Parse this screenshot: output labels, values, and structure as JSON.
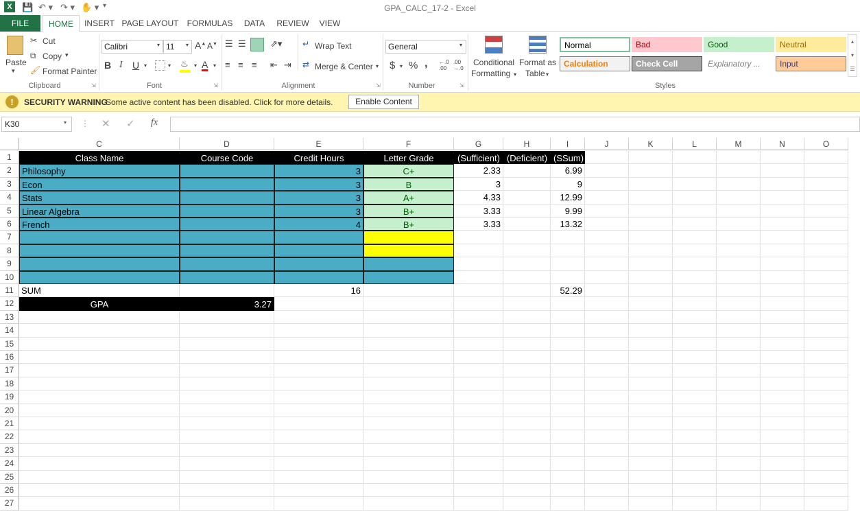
{
  "window": {
    "title": "GPA_CALC_17-2 - Excel"
  },
  "quick_access": {
    "save_icon": "save-icon",
    "undo_icon": "undo-icon",
    "redo_icon": "redo-icon",
    "touch_icon": "touch-mode-icon",
    "customize_icon": "customize-icon"
  },
  "tabs": [
    "FILE",
    "HOME",
    "INSERT",
    "PAGE LAYOUT",
    "FORMULAS",
    "DATA",
    "REVIEW",
    "VIEW"
  ],
  "ribbon": {
    "clipboard": {
      "paste": "Paste",
      "cut": "Cut",
      "copy": "Copy",
      "format_painter": "Format Painter",
      "label": "Clipboard"
    },
    "font": {
      "name": "Calibri",
      "size": "11",
      "label": "Font",
      "bold": "B",
      "italic": "I",
      "underline": "U"
    },
    "alignment": {
      "wrap_text": "Wrap Text",
      "merge_center": "Merge & Center",
      "label": "Alignment"
    },
    "number": {
      "format": "General",
      "label": "Number",
      "currency": "$",
      "percent": "%",
      "comma": ","
    },
    "cond_format": {
      "line1": "Conditional",
      "line2": "Formatting"
    },
    "format_table": {
      "line1": "Format as",
      "line2": "Table"
    },
    "styles": {
      "label": "Styles",
      "items": [
        {
          "name": "Normal",
          "bg": "#ffffff",
          "fg": "#000000",
          "border": "#7fbf9f"
        },
        {
          "name": "Bad",
          "bg": "#ffc7ce",
          "fg": "#9c0006"
        },
        {
          "name": "Good",
          "bg": "#c6efce",
          "fg": "#006100"
        },
        {
          "name": "Neutral",
          "bg": "#ffeb9c",
          "fg": "#9c6500"
        },
        {
          "name": "Calculation",
          "bg": "#f2f2f2",
          "fg": "#fa7d00",
          "border": "#7f7f7f"
        },
        {
          "name": "Check Cell",
          "bg": "#a5a5a5",
          "fg": "#ffffff",
          "border": "#3f3f3f"
        },
        {
          "name": "Explanatory ...",
          "bg": "#ffffff",
          "fg": "#7f7f7f"
        },
        {
          "name": "Input",
          "bg": "#ffcc99",
          "fg": "#3f3f76",
          "border": "#7f7f7f"
        }
      ]
    }
  },
  "security": {
    "title": "SECURITY WARNING",
    "message": "Some active content has been disabled. Click for more details.",
    "button": "Enable Content"
  },
  "formula_bar": {
    "name_box": "K30",
    "fx": "fx",
    "value": ""
  },
  "columns": [
    "C",
    "D",
    "E",
    "F",
    "G",
    "H",
    "I",
    "J",
    "K",
    "L",
    "M",
    "N",
    "O"
  ],
  "rows": [
    "1",
    "2",
    "3",
    "4",
    "5",
    "6",
    "7",
    "8",
    "9",
    "10",
    "11",
    "12",
    "13",
    "14",
    "15",
    "16",
    "17",
    "18",
    "19",
    "20",
    "21",
    "22",
    "23",
    "24",
    "25",
    "26",
    "27"
  ],
  "sheet": {
    "headers": [
      "Class Name",
      "Course Code",
      "Credit Hours",
      "Letter Grade",
      "(Sufficient)",
      "(Deficient)",
      "(SSum)"
    ],
    "classes": [
      {
        "name": "Philosophy",
        "code": "",
        "hours": "3",
        "grade": "C+",
        "sufficient": "2.33",
        "deficient": "",
        "ssum": "6.99"
      },
      {
        "name": "Econ",
        "code": "",
        "hours": "3",
        "grade": "B",
        "sufficient": "3",
        "deficient": "",
        "ssum": "9"
      },
      {
        "name": "Stats",
        "code": "",
        "hours": "3",
        "grade": "A+",
        "sufficient": "4.33",
        "deficient": "",
        "ssum": "12.99"
      },
      {
        "name": "Linear Algebra",
        "code": "",
        "hours": "3",
        "grade": "B+",
        "sufficient": "3.33",
        "deficient": "",
        "ssum": "9.99"
      },
      {
        "name": "French",
        "code": "",
        "hours": "4",
        "grade": "B+",
        "sufficient": "3.33",
        "deficient": "",
        "ssum": "13.32"
      }
    ],
    "sum_label": "SUM",
    "sum_hours": "16",
    "sum_ssum": "52.29",
    "gpa_label": "GPA",
    "gpa_value": "3.27",
    "colors": {
      "teal": "#4bacc6",
      "green_cell": "#c6efce",
      "green_text": "#006100",
      "yellow": "#ffff00",
      "header_bg": "#000000"
    }
  }
}
